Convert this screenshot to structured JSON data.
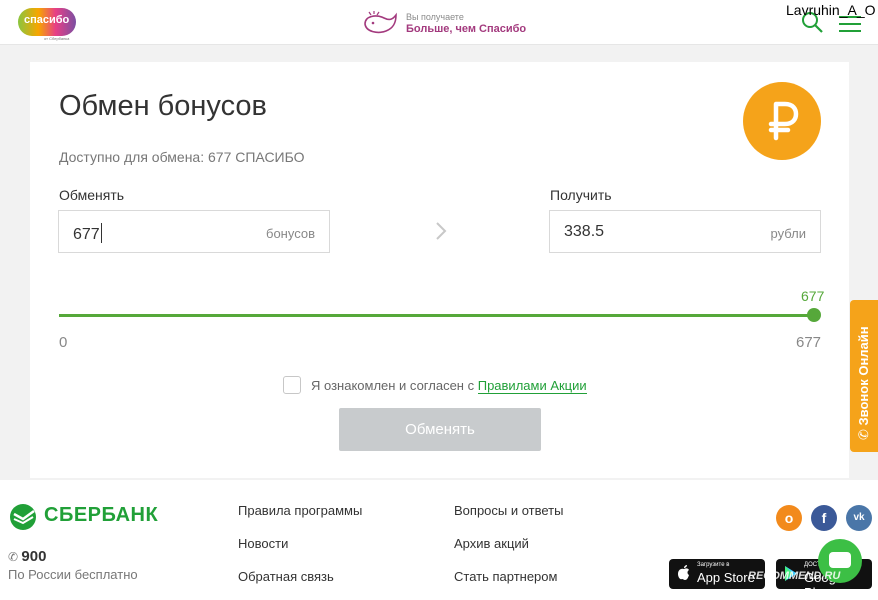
{
  "header": {
    "logo_text": "спасибо",
    "logo_sub": "от Сбербанка",
    "promo_small": "Вы получаете",
    "promo_big": "Больше, чем Спасибо",
    "username": "Lavruhin_A_O",
    "icons": [
      "search-icon",
      "menu-icon"
    ]
  },
  "exchange": {
    "title": "Обмен бонусов",
    "available": "Доступно для обмена: 677 СПАСИБО",
    "from_label": "Обменять",
    "from_value": "677",
    "from_unit": "бонусов",
    "to_label": "Получить",
    "to_value": "338.5",
    "to_unit": "рубли",
    "slider": {
      "value_label": "677",
      "min_label": "0",
      "max_label": "677",
      "value": 677,
      "min": 0,
      "max": 677
    },
    "agree_text": "Я ознакомлен и согласен с ",
    "agree_link": "Правилами Акции",
    "agree_checked": false,
    "submit_label": "Обменять",
    "badge_icon": "ruble-icon"
  },
  "side_tab": {
    "label": "Звонок Онлайн",
    "icon": "phone-icon"
  },
  "footer": {
    "brand": "СБЕРБАНК",
    "phone": "900",
    "phone_sub": "По России бесплатно",
    "links_col1": [
      "Правила программы",
      "Новости",
      "Обратная связь"
    ],
    "links_col2": [
      "Вопросы и ответы",
      "Архив акций",
      "Стать партнером"
    ],
    "social": [
      "odnoklassniki-icon",
      "facebook-icon",
      "vk-icon"
    ],
    "appstore_small": "Загрузите в",
    "appstore_big": "App Store",
    "googleplay_small": "ДОСТУПНО В",
    "googleplay_big": "Google Play",
    "watermark": "RECOMMEND.RU"
  },
  "colors": {
    "accent_green": "#21a038",
    "slider_green": "#56a83a",
    "orange": "#f5a31a",
    "disabled_button": "#c8cbcd"
  }
}
